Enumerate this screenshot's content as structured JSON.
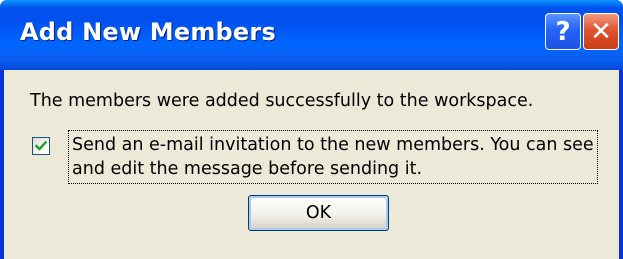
{
  "window": {
    "title": "Add New Members",
    "help_label": "?",
    "close_label": "✕"
  },
  "dialog": {
    "message": "The members were added successfully to the workspace.",
    "checkbox": {
      "checked": true,
      "label": "Send an e-mail invitation to the new members. You can see and edit the message before sending it."
    },
    "ok_label": "OK"
  },
  "colors": {
    "titlebar": "#0058ee",
    "client": "#ece9d8",
    "close_button": "#e0552f",
    "check_mark": "#21a121"
  }
}
